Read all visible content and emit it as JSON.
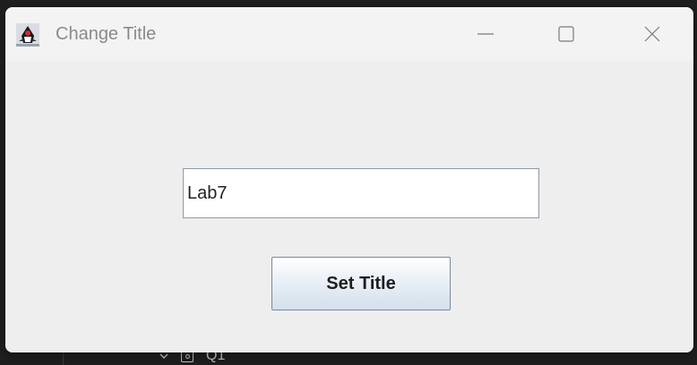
{
  "window": {
    "title": "Change Title"
  },
  "form": {
    "title_input_value": "Lab7",
    "set_title_button_label": "Set Title"
  },
  "background_app": {
    "tree_item_label": "Q1"
  },
  "icons": {
    "app_icon": "java-duke-icon",
    "minimize": "minimize-icon",
    "maximize": "maximize-icon",
    "close": "close-icon"
  },
  "colors": {
    "window_bg": "#eeeeee",
    "titlebar_bg": "#f3f3f3",
    "title_text": "#8a8a8a",
    "button_gradient_top": "#ffffff",
    "button_gradient_bottom": "#d3e0ec",
    "button_border": "#7a8a99"
  }
}
